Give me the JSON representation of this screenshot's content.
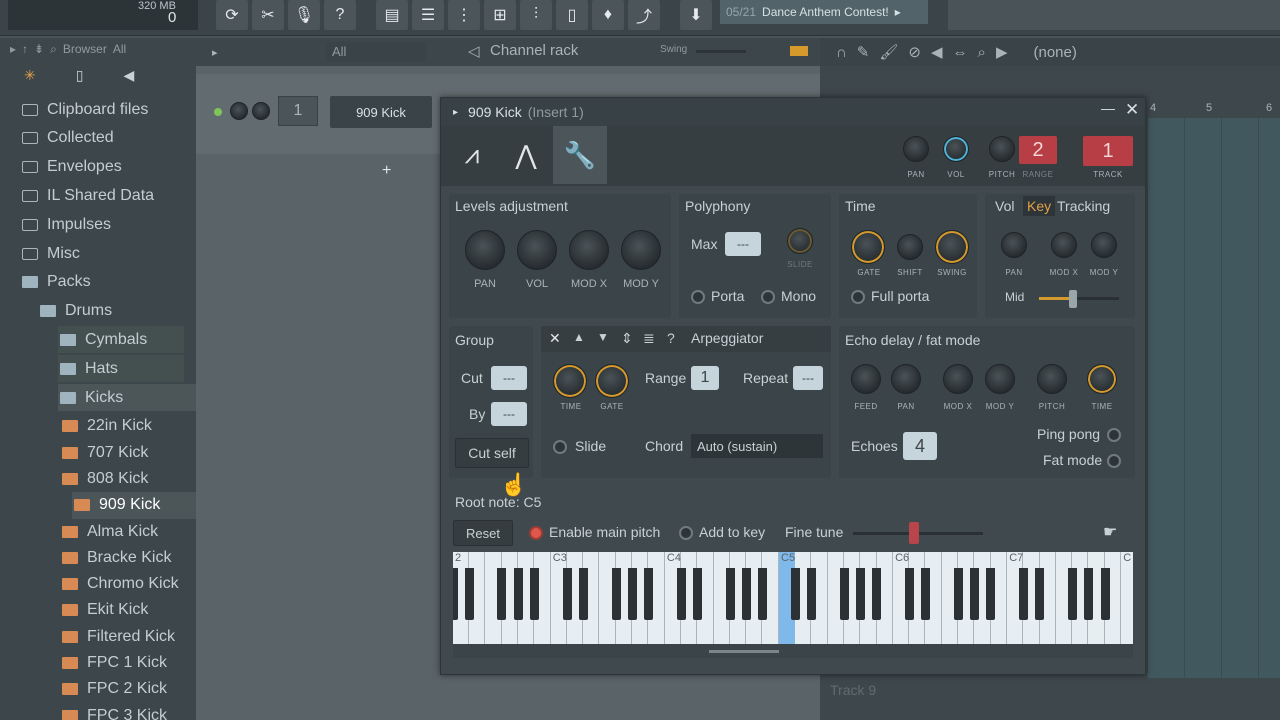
{
  "topbar": {
    "cpu_mem": "320 MB",
    "cpu_value": "0",
    "hint_date": "05/21",
    "hint_text": "Dance Anthem Contest!"
  },
  "browser": {
    "title": "Browser",
    "filter": "All",
    "items": [
      {
        "label": "Clipboard files",
        "type": "folder",
        "indent": 0
      },
      {
        "label": "Collected",
        "type": "folder",
        "indent": 0
      },
      {
        "label": "Envelopes",
        "type": "folder",
        "indent": 0
      },
      {
        "label": "IL Shared Data",
        "type": "folder",
        "indent": 0
      },
      {
        "label": "Impulses",
        "type": "folder",
        "indent": 0
      },
      {
        "label": "Misc",
        "type": "folder",
        "indent": 0
      },
      {
        "label": "Packs",
        "type": "pack",
        "indent": 0
      },
      {
        "label": "Drums",
        "type": "pack",
        "indent": 1
      },
      {
        "label": "Cymbals",
        "type": "pack",
        "indent": 2
      },
      {
        "label": "Hats",
        "type": "pack",
        "indent": 2
      },
      {
        "label": "Kicks",
        "type": "pack",
        "indent": 2
      },
      {
        "label": "22in Kick",
        "type": "sample",
        "indent": 3
      },
      {
        "label": "707 Kick",
        "type": "sample",
        "indent": 3
      },
      {
        "label": "808 Kick",
        "type": "sample",
        "indent": 3
      },
      {
        "label": "909 Kick",
        "type": "sample",
        "indent": 4
      },
      {
        "label": "Alma Kick",
        "type": "sample",
        "indent": 3
      },
      {
        "label": "Bracke Kick",
        "type": "sample",
        "indent": 3
      },
      {
        "label": "Chromo Kick",
        "type": "sample",
        "indent": 3
      },
      {
        "label": "Ekit Kick",
        "type": "sample",
        "indent": 3
      },
      {
        "label": "Filtered Kick",
        "type": "sample",
        "indent": 3
      },
      {
        "label": "FPC 1 Kick",
        "type": "sample",
        "indent": 3
      },
      {
        "label": "FPC 2 Kick",
        "type": "sample",
        "indent": 3
      },
      {
        "label": "FPC 3 Kick",
        "type": "sample",
        "indent": 3
      }
    ]
  },
  "rack": {
    "filter": "All",
    "title": "Channel rack",
    "swing_label": "Swing",
    "channel_number": "1",
    "channel_name": "909 Kick",
    "add_symbol": "+"
  },
  "playlist": {
    "snap": "(none)",
    "bar4": "4",
    "bar5": "5",
    "bar6": "6",
    "track9": "Track 9"
  },
  "plugin": {
    "title": "909 Kick",
    "insert": "(Insert 1)",
    "top_knobs": {
      "pan": "PAN",
      "vol": "VOL",
      "pitch": "PITCH",
      "range": "RANGE",
      "track": "TRACK",
      "range_value": "2",
      "track_value": "1"
    },
    "levels": {
      "title": "Levels adjustment",
      "pan": "PAN",
      "vol": "VOL",
      "modx": "MOD X",
      "mody": "MOD Y"
    },
    "polyphony": {
      "title": "Polyphony",
      "max": "Max",
      "max_value": "---",
      "slide": "SLIDE",
      "porta": "Porta",
      "mono": "Mono"
    },
    "time": {
      "title": "Time",
      "gate": "GATE",
      "shift": "SHIFT",
      "swing": "SWING",
      "full_porta": "Full porta"
    },
    "tracking": {
      "vol": "Vol",
      "key": "Key",
      "title": "Tracking",
      "pan": "PAN",
      "modx": "MOD X",
      "mody": "MOD Y",
      "mid": "Mid"
    },
    "group": {
      "title": "Group",
      "cut": "Cut",
      "by": "By",
      "cut_value": "---",
      "by_value": "---",
      "cut_self": "Cut self"
    },
    "arp": {
      "title": "Arpeggiator",
      "time": "TIME",
      "gate": "GATE",
      "range": "Range",
      "range_value": "1",
      "repeat": "Repeat",
      "repeat_value": "---",
      "slide": "Slide",
      "chord": "Chord",
      "chord_value": "Auto (sustain)"
    },
    "echo": {
      "title": "Echo delay / fat mode",
      "feed": "FEED",
      "pan": "PAN",
      "modx": "MOD X",
      "mody": "MOD Y",
      "pitch": "PITCH",
      "time": "TIME",
      "echoes": "Echoes",
      "echoes_value": "4",
      "ping_pong": "Ping pong",
      "fat_mode": "Fat mode"
    },
    "root_note": "Root note: C5",
    "reset": "Reset",
    "enable_main_pitch": "Enable main pitch",
    "add_to_key": "Add to key",
    "fine_tune": "Fine tune",
    "octaves": [
      "2",
      "C3",
      "C4",
      "C5",
      "C6",
      "C7",
      "C"
    ]
  },
  "colors": {
    "accent_orange": "#d69a2c",
    "accent_blue": "#4fb2d6",
    "red_badge": "#b83e45",
    "highlight_key": "#7fb9ea"
  }
}
